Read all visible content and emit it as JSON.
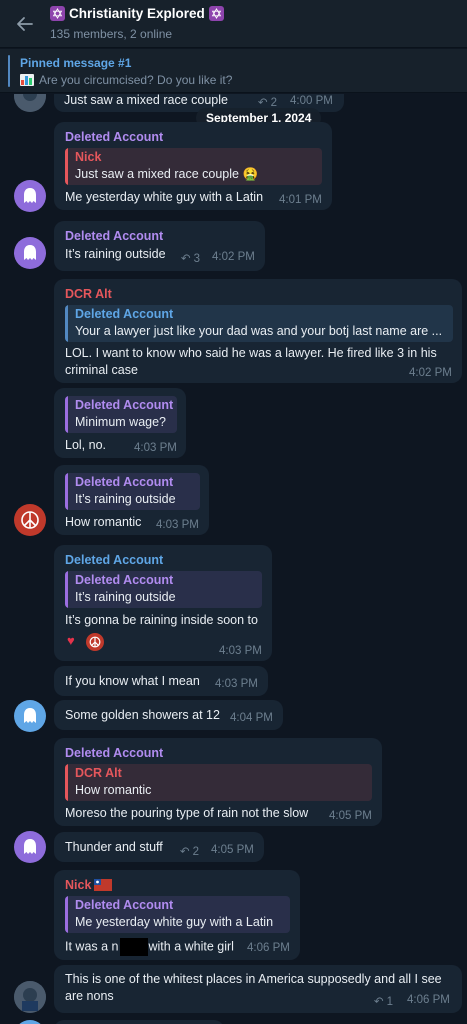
{
  "header": {
    "title": "Christianity Explored",
    "subtitle": "135 members, 2 online"
  },
  "pinned": {
    "title": "Pinned message #1",
    "text": "Are you circumcised? Do you like it?"
  },
  "date_separator": "September 1, 2024",
  "messages": [
    {
      "text": "Just saw a mixed race couple",
      "replies": "2",
      "time": "4:00 PM"
    },
    {
      "author": "Deleted Account",
      "quote_author": "Nick",
      "quote_text": "Just saw a mixed race couple 🤮",
      "text": "Me yesterday white guy with a Latin",
      "time": "4:01 PM"
    },
    {
      "author": "Deleted Account",
      "text": "It’s raining outside",
      "replies": "3",
      "time": "4:02 PM"
    },
    {
      "author": "DCR Alt",
      "quote_author": "Deleted Account",
      "quote_text": "Your a lawyer just like your dad was and your botj last name are ...",
      "text": "LOL. I want to know who said he was a lawyer. He fired like 3 in his criminal case",
      "time": "4:02 PM"
    },
    {
      "quote_author": "Deleted Account",
      "quote_text": "Minimum wage?",
      "text": "Lol, no.",
      "time": "4:03 PM"
    },
    {
      "quote_author": "Deleted Account",
      "quote_text": "It’s raining outside",
      "text": "How romantic",
      "time": "4:03 PM"
    },
    {
      "author": "Deleted Account",
      "quote_author": "Deleted Account",
      "quote_text": "It’s raining outside",
      "text": "It’s gonna be raining inside soon to",
      "time": "4:03 PM"
    },
    {
      "text": "If you know what I mean",
      "time": "4:03 PM"
    },
    {
      "text": "Some golden showers at 12",
      "time": "4:04 PM"
    },
    {
      "author": "Deleted Account",
      "quote_author": "DCR Alt",
      "quote_text": "How romantic",
      "text": "Moreso the pouring type of rain not the slow",
      "time": "4:05 PM"
    },
    {
      "text": "Thunder and stuff",
      "replies": "2",
      "time": "4:05 PM"
    },
    {
      "author": "Nick",
      "quote_author": "Deleted Account",
      "quote_text": "Me yesterday white guy with a Latin",
      "text_before": "It was a n",
      "text_after": "with a white girl",
      "time": "4:06 PM"
    },
    {
      "text": "This is one of the whitest places in America supposedly and all I see are nons",
      "replies": "1",
      "time": "4:06 PM"
    }
  ],
  "colors": {
    "background": "#0e1621",
    "header": "#17212b",
    "bubble": "#182533",
    "accent": "#5fa6e6",
    "author_purple": "#b18cf0",
    "author_red": "#e5575c"
  }
}
